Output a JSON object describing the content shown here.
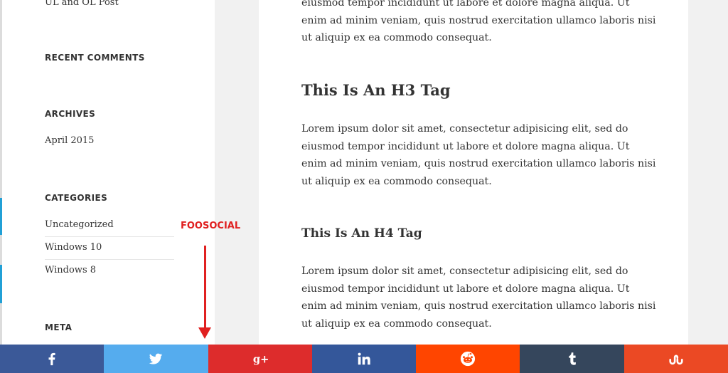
{
  "sidebar": {
    "top_link": "UL and OL Post",
    "recent_comments_heading": "RECENT COMMENTS",
    "archives_heading": "ARCHIVES",
    "archives": [
      "April 2015"
    ],
    "categories_heading": "CATEGORIES",
    "categories": [
      "Uncategorized",
      "Windows 10",
      "Windows 8"
    ],
    "meta_heading": "META"
  },
  "content": {
    "para_top": "eiusmod tempor incididunt ut labore et dolore magna aliqua. Ut enim ad minim veniam, quis nostrud exercitation ullamco laboris nisi ut aliquip ex ea commodo consequat.",
    "h3": "This Is An H3 Tag",
    "para_h3": "Lorem ipsum dolor sit amet, consectetur adipisicing elit, sed do eiusmod tempor incididunt ut labore et dolore magna aliqua. Ut enim ad minim veniam, quis nostrud exercitation ullamco laboris nisi ut aliquip ex ea commodo consequat.",
    "h4": "This Is An H4 Tag",
    "para_h4": "Lorem ipsum dolor sit amet, consectetur adipisicing elit, sed do eiusmod tempor incididunt ut labore et dolore magna aliqua. Ut enim ad minim veniam, quis nostrud exercitation ullamco laboris nisi ut aliquip ex ea commodo consequat."
  },
  "annotation": {
    "label": "FOOSOCIAL"
  },
  "share_bar": [
    {
      "network": "facebook",
      "icon": "facebook-icon",
      "color": "#3b5998"
    },
    {
      "network": "twitter",
      "icon": "twitter-icon",
      "color": "#55acee"
    },
    {
      "network": "google-plus",
      "icon": "google-plus-icon",
      "color": "#dd2c2c"
    },
    {
      "network": "linkedin",
      "icon": "linkedin-icon",
      "color": "#34579a"
    },
    {
      "network": "reddit",
      "icon": "reddit-icon",
      "color": "#ff4500"
    },
    {
      "network": "tumblr",
      "icon": "tumblr-icon",
      "color": "#35465c"
    },
    {
      "network": "stumbleupon",
      "icon": "stumbleupon-icon",
      "color": "#eb4924"
    }
  ]
}
